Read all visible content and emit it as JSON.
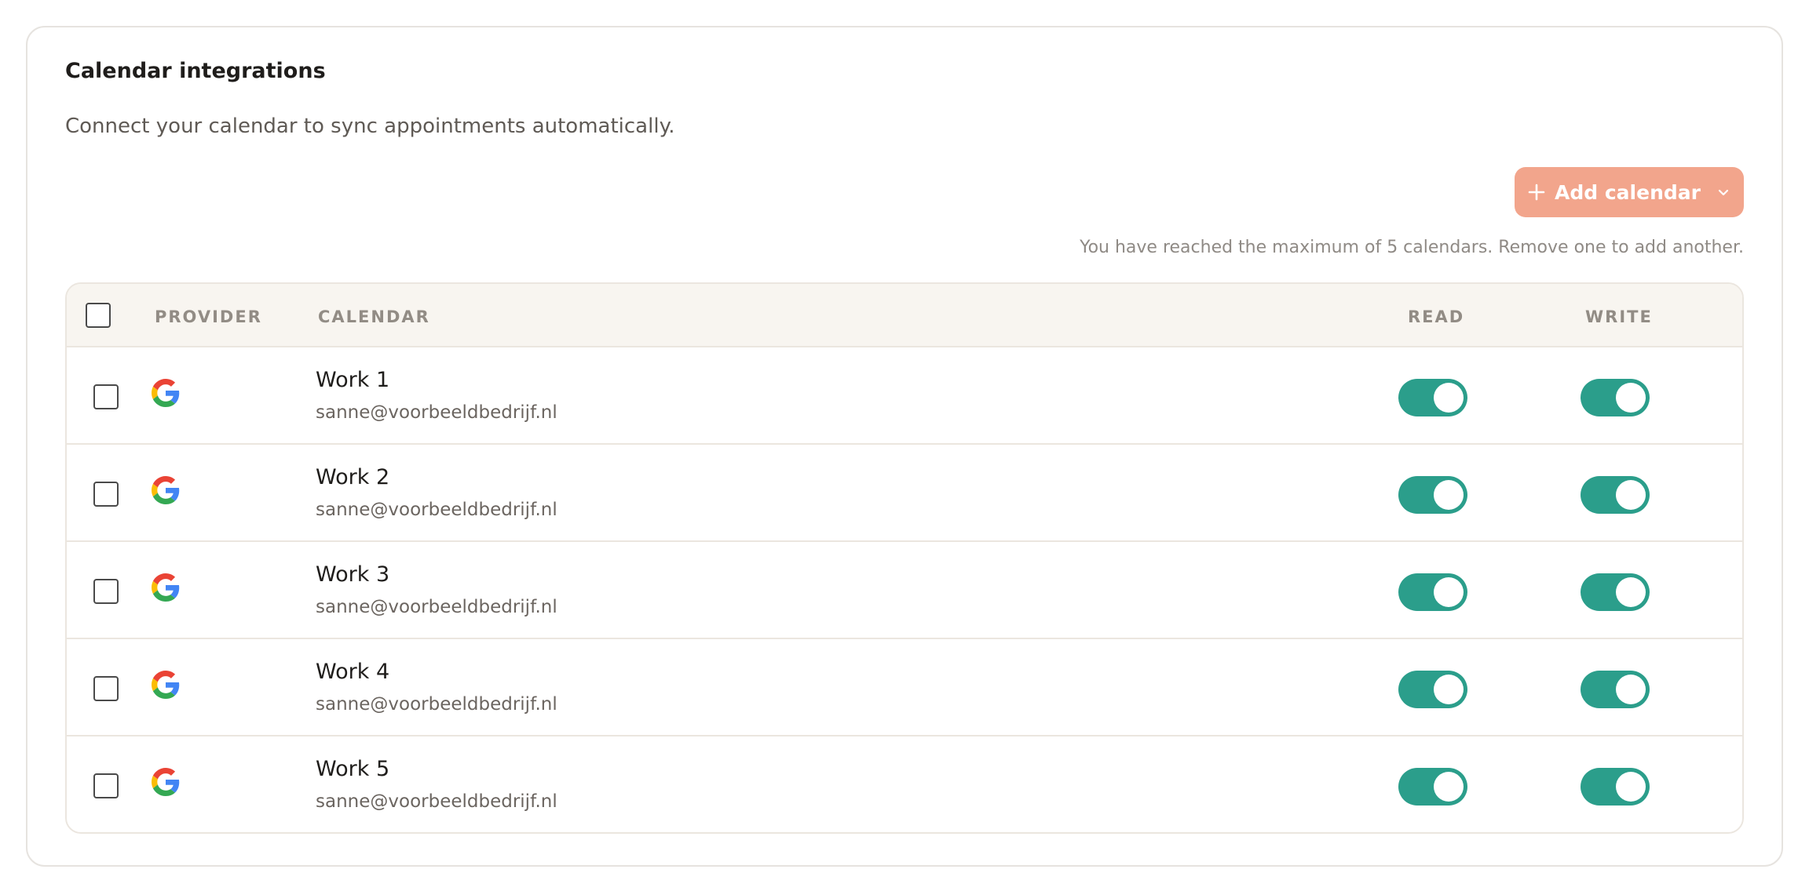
{
  "section": {
    "title": "Calendar integrations",
    "description": "Connect your calendar to sync appointments automatically.",
    "add_button_label": "Add calendar",
    "limit_note": "You have reached the maximum of 5 calendars. Remove one to add another."
  },
  "table": {
    "headers": {
      "provider": "PROVIDER",
      "calendar": "CALENDAR",
      "read": "READ",
      "write": "WRITE"
    },
    "rows": [
      {
        "provider": "google-icon",
        "name": "Work 1",
        "email": "sanne@voorbeeldbedrijf.nl",
        "read": true,
        "write": true,
        "selected": false
      },
      {
        "provider": "google-icon",
        "name": "Work 2",
        "email": "sanne@voorbeeldbedrijf.nl",
        "read": true,
        "write": true,
        "selected": false
      },
      {
        "provider": "google-icon",
        "name": "Work 3",
        "email": "sanne@voorbeeldbedrijf.nl",
        "read": true,
        "write": true,
        "selected": false
      },
      {
        "provider": "google-icon",
        "name": "Work 4",
        "email": "sanne@voorbeeldbedrijf.nl",
        "read": true,
        "write": true,
        "selected": false
      },
      {
        "provider": "google-icon",
        "name": "Work 5",
        "email": "sanne@voorbeeldbedrijf.nl",
        "read": true,
        "write": true,
        "selected": false
      }
    ]
  },
  "colors": {
    "accent_button": "#f2a58c",
    "toggle_on": "#2b9e8b",
    "header_bg": "#f8f5f0"
  }
}
